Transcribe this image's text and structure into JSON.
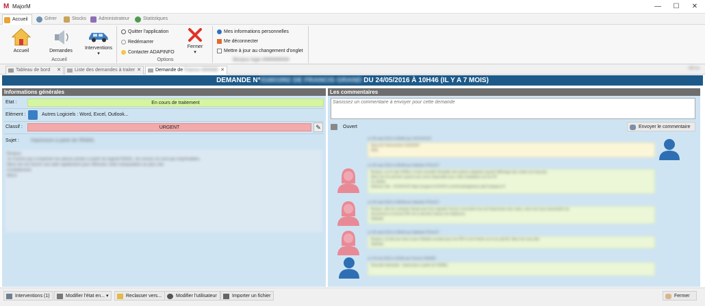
{
  "window": {
    "title": "MajorM",
    "min_label": "—",
    "max_label": "☐",
    "close_label": "✕"
  },
  "menu": {
    "tabs": [
      {
        "label": "Accueil",
        "color": "#e8a33a"
      },
      {
        "label": "Gérer",
        "color": "#6c8fb0"
      },
      {
        "label": "Stocks",
        "color": "#c9a45a"
      },
      {
        "label": "Administrateur",
        "color": "#8d6fb5"
      },
      {
        "label": "Statistiques",
        "color": "#4d9b4d"
      }
    ]
  },
  "ribbon": {
    "accueil_group": {
      "accueil": "Accueil",
      "demandes": "Demandes",
      "interventions": "Interventions",
      "label": "Accueil"
    },
    "options_group": {
      "quitter": "Quitter l'application",
      "redemarrer": "Redémarrer",
      "contacter": "Contacter ADAPINFO",
      "fermer": "Fermer",
      "label": "Options"
    },
    "user_group": {
      "infos": "Mes informations personnelles",
      "deconnecter": "Me déconnecter",
      "maj": "Mettre à jour au changement d'onglet",
      "user": "Bonjour login ##########"
    }
  },
  "doctabs": [
    {
      "label": "Tableau de bord"
    },
    {
      "label": "Liste des demandes à traiter"
    },
    {
      "label": "Demande de"
    }
  ],
  "doctabs_extra": {
    "blurred_name": "Francis GRAND",
    "right_info": "249 ms"
  },
  "header": {
    "prefix": "DEMANDE N°",
    "blurred": "01601992 DE FRANCIS GRAND",
    "suffix": "DU 24/05/2016 À 10H46 (IL Y A 7 MOIS)"
  },
  "info": {
    "title": "Informations générales",
    "etat_label": "Etat :",
    "etat_value": "En cours de traitement",
    "etat_color": "#d6f5a0",
    "element_label": "Elément :",
    "element_value": "Autres Logiciels  : Word, Excel, Outlook...",
    "classif_label": "Classif :",
    "classif_value": "URGENT",
    "classif_color": "#f4aaaa",
    "sujet_label": "Sujet :",
    "sujet_value": "Impression à partir de l'EMAIL",
    "body": [
      "Bonjour,",
      "Je n'arrive pas à imprimer les pièces jointes à partir du logiciel EMAIL, les envois ne sont pas imprimables.",
      "Merci de me fournir une aide rapidement pour effectuer cette manipulation au plus vite.",
      "Cordialement",
      "Merci"
    ]
  },
  "comments": {
    "title": "Les commentaires",
    "placeholder": "Saisissez un commentaire à envoyer pour cette demande",
    "status": "Ouvert",
    "send_label": "Envoyer le commentaire",
    "items": [
      {
        "meta": "Le 05 sept 2016 à 09h46 par ##########",
        "lines": [
          "Ajout de l'intervention 01602397",
          "RAS"
        ],
        "side": "right",
        "avatar": "blue",
        "style": "yellow"
      },
      {
        "meta": "Le 05 sept 2016 à 09h48 par Nathalie POULET",
        "lines": [
          "Bonjour, sur le site d'Office, le fait conseillé d'installer des polices adaptées quand l'affichage des codes est mauvais.",
          "Merci de me préciser quand vous serez disponible pour cette installation sur les PC",
          "Si, Adobe",
          "Adresse Site : ######### https://support.#######.com/knowledgebase.php?category=4"
        ],
        "side": "left",
        "avatar": "pink",
        "style": "green"
      },
      {
        "meta": "Le 05 sept 2016 à 09h48 par Nathalie POULET",
        "lines": [
          "Bonjour, afin de contacter Rivale pour leur signaler l'erreur rencontrée lors de l'impression des notes, merci de nous transmettre les",
          "documents en format PDF de la dernière facture de téléphone.",
          "Nathalie"
        ],
        "side": "left",
        "avatar": "pink",
        "style": "green"
      },
      {
        "meta": "Le 05 sept 2016 à 09h46 par Nathalie POULET",
        "lines": [
          "Bonjour, j'ai fait une mise à jour d'Adobe acrobat pour les PDF et de Firefox sur le pc pdt 06. Merci de nous dire.",
          "Nathalie"
        ],
        "side": "left",
        "avatar": "pink",
        "style": "green"
      },
      {
        "meta": "Le 24 mai 2016 à 10h46 par Francis GRAND",
        "lines": [
          "Nouvelle demande : Impression à partir de l'EMAIL"
        ],
        "side": "left",
        "avatar": "blue",
        "style": "green"
      }
    ]
  },
  "bottombar": {
    "interventions": "Interventions (1)",
    "modifier_etat": "Modifier l'état en...",
    "reclasser": "Reclasser vers...",
    "modifier_user": "Modifier l'utilisateur",
    "importer": "Importer un fichier",
    "fermer": "Fermer"
  },
  "colors": {
    "header_bg": "#1d5a8a",
    "panel_bg": "#cfe4f3",
    "avatar_pink": "#e88a96",
    "avatar_blue": "#2e6fb3"
  }
}
